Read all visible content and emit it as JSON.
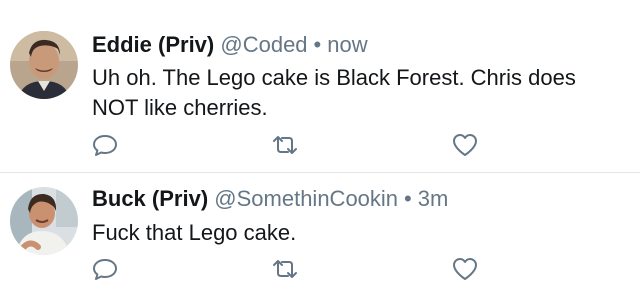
{
  "tweets": [
    {
      "name": "Eddie (Priv)",
      "handle": "@Coded",
      "separator": "•",
      "time": "now",
      "text": "Uh oh. The Lego cake is Black Forest. Chris does NOT like cherries.",
      "avatar_icon": "user-avatar-photo"
    },
    {
      "name": "Buck (Priv)",
      "handle": "@SomethinCookin",
      "separator": "•",
      "time": "3m",
      "text": "Fuck that Lego cake.",
      "avatar_icon": "user-avatar-photo"
    }
  ],
  "icons": {
    "reply": "speech-bubble-icon",
    "retweet": "retweet-icon",
    "like": "heart-icon"
  },
  "colors": {
    "text": "#14171a",
    "secondary": "#657786",
    "icon": "#657786",
    "divider": "#e1e8ed"
  }
}
